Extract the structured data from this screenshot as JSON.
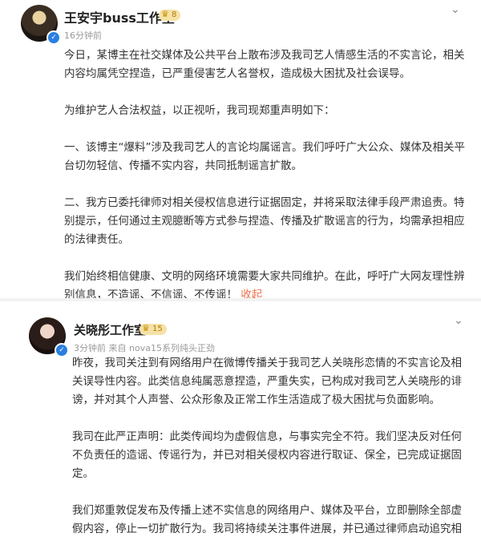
{
  "post1": {
    "account_name": "王安宇buss工作室",
    "badge_level": "8",
    "timestamp": "16分钟前",
    "paragraphs": [
      "今日，某博主在社交媒体及公共平台上散布涉及我司艺人情感生活的不实言论，相关内容均属凭空捏造，已严重侵害艺人名誉权，造成极大困扰及社会误导。",
      "为维护艺人合法权益，以正视听，我司现郑重声明如下：",
      "一、该博主“爆料”涉及我司艺人的言论均属谣言。我们呼吁广大公众、媒体及相关平台切勿轻信、传播不实内容，共同抵制谣言扩散。",
      "二、我方已委托律师对相关侵权信息进行证据固定，并将采取法律手段严肃追责。特别提示，任何通过主观臆断等方式参与捏造、传播及扩散谣言的行为，均需承担相应的法律责任。",
      "我们始终相信健康、文明的网络环境需要大家共同维护。在此，呼吁广大网友理性辨别信息，不造谣、不信谣、不传谣！"
    ],
    "collapse_label": "收起"
  },
  "post2": {
    "account_name": "关晓彤工作室",
    "badge_level": "15",
    "timestamp": "3分钟前 来自 nova15系列纯头正劲",
    "paragraphs": [
      "昨夜，我司关注到有网络用户在微博传播关于我司艺人关晓彤恋情的不实言论及相关误导性内容。此类信息纯属恶意捏造，严重失实，已构成对我司艺人关晓彤的诽谤，并对其个人声誉、公众形象及正常工作生活造成了极大困扰与负面影响。",
      "我司在此严正声明：此类传闻均为虚假信息，与事实完全不符。我们坚决反对任何不负责任的造谣、传谣行为，并已对相关侵权内容进行取证、保全，已完成证据固定。",
      "我们郑重敦促发布及传播上述不实信息的网络用户、媒体及平台，立即删除全部虚假内容，停止一切扩散行为。我司将持续关注事件进展，并已通过律师启动追究相"
    ]
  },
  "icons": {
    "verified": "verified-badge-icon",
    "crown": "vip-crown-icon",
    "menu": "chevron-down-icon"
  },
  "colors": {
    "verified_blue": "#2b7fe0",
    "collapse_orange": "#eb7350",
    "vip_gold": "#f6e2a6"
  }
}
